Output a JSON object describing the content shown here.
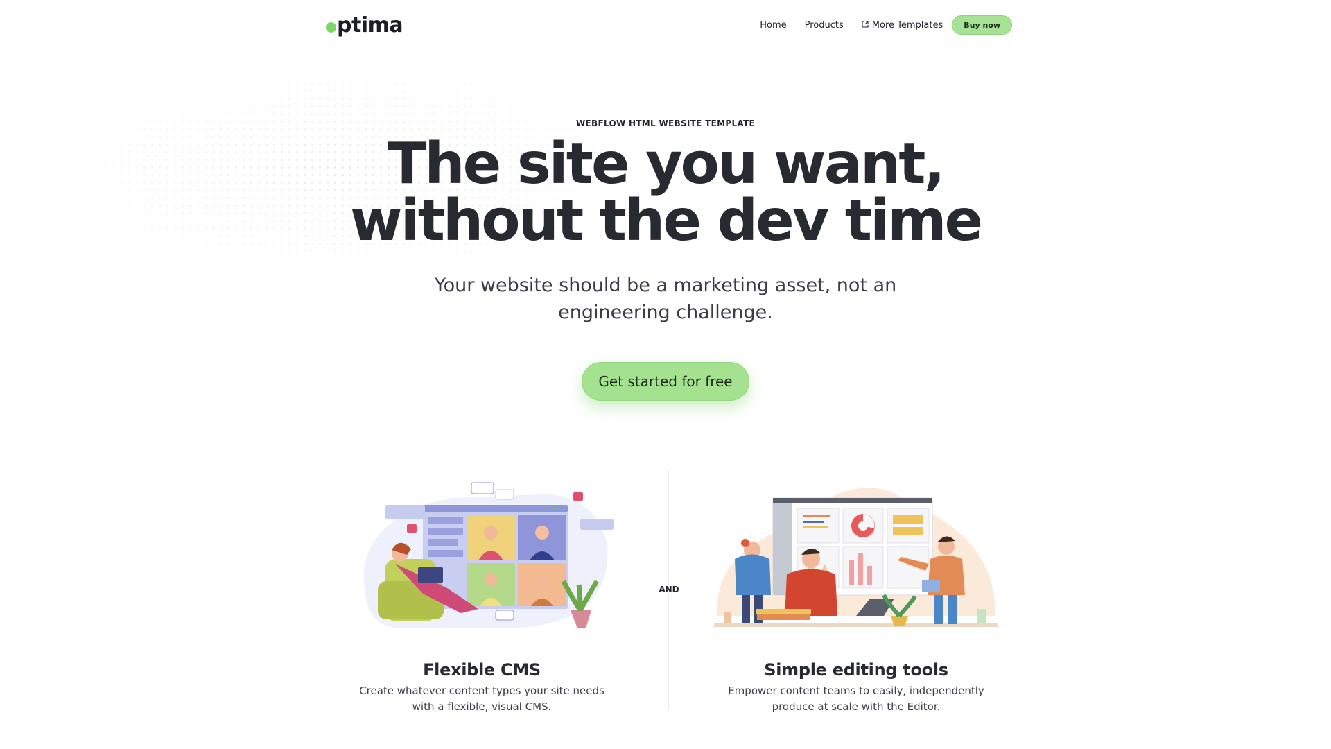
{
  "nav": {
    "logo_text": "ptima",
    "links": [
      {
        "label": "Home"
      },
      {
        "label": "Products"
      },
      {
        "label": "More Templates",
        "icon": "external-link-icon"
      }
    ],
    "buy_label": "Buy now"
  },
  "hero": {
    "eyebrow": "WEBFLOW HTML WEBSITE TEMPLATE",
    "headline_line1": "The site you want,",
    "headline_line2": "without the dev time",
    "subtitle_line1": "Your website should be a marketing asset, not an",
    "subtitle_line2": "engineering challenge.",
    "cta_label": "Get started for free"
  },
  "features": {
    "and_label": "AND",
    "left": {
      "title": "Flexible CMS",
      "desc_line1": "Create whatever content types your site needs",
      "desc_line2": "with a flexible, visual CMS."
    },
    "right": {
      "title": "Simple editing tools",
      "desc_line1": "Empower content teams to easily, independently",
      "desc_line2": "produce at scale with the Editor."
    }
  },
  "colors": {
    "accent_green": "#a5e28f",
    "logo_dot": "#78d967",
    "text_dark": "#23262f"
  }
}
